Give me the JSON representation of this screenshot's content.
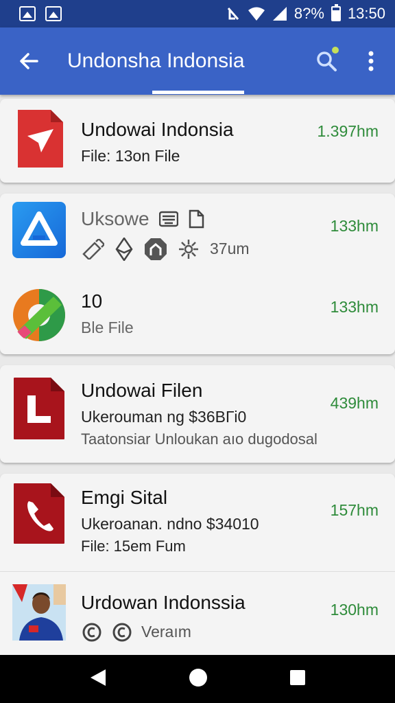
{
  "status_bar": {
    "battery_text": "8?%",
    "time": "13:50"
  },
  "app_bar": {
    "title": "Undonsha Indonsia"
  },
  "items": [
    {
      "title": "Undowai Indonsia",
      "subtitle": "File: 13on File",
      "meta": "1.397hm",
      "icon": "pdf-document-icon"
    },
    {
      "title": "Uksowe",
      "subtitle": "37um",
      "meta": "133hm",
      "icon": "drive-triangle-icon"
    },
    {
      "title": "10",
      "subtitle": "Ble File",
      "meta": "133hm",
      "icon": "colorful-app-icon"
    },
    {
      "title": "Undowai Filen",
      "subtitle": "Ukeroumаn ng $36ВГі0",
      "line3": "Taatonsiar Unloukan aıo dugodosal",
      "meta": "439hm",
      "icon": "red-l-document-icon"
    },
    {
      "title": "Emgi Sital",
      "subtitle": "Ukeroanan. ndno $34010",
      "line3": "File:  15em Fum",
      "meta": "157hm",
      "icon": "phone-document-icon"
    },
    {
      "title": "Urdowan Indonssia",
      "subtitle": "Veraım",
      "meta": "130hm",
      "icon": "person-photo-icon"
    }
  ],
  "colors": {
    "status_bar": "#1f3f8c",
    "app_bar": "#3a63c6",
    "meta_green": "#2e8b3a"
  }
}
